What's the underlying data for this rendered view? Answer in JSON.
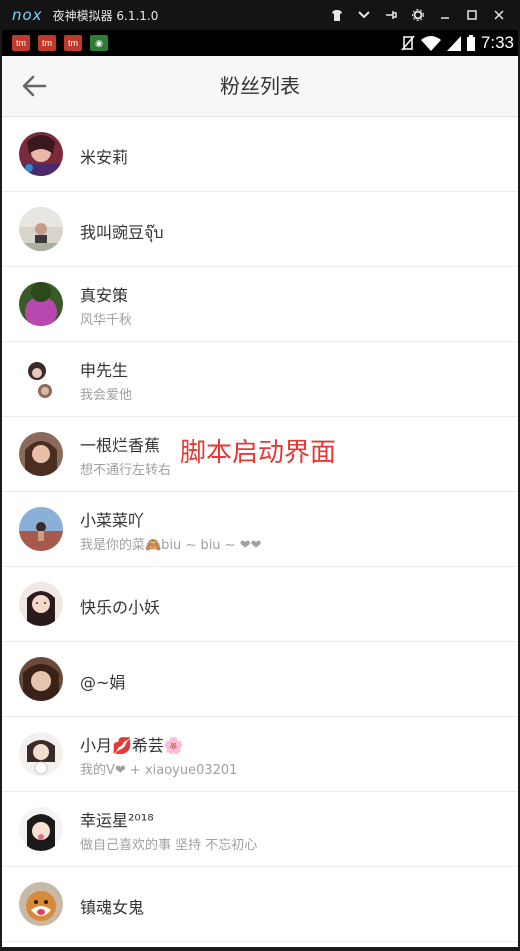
{
  "emulator": {
    "logo": "nox",
    "title": "夜神模拟器 6.1.1.0",
    "controls": [
      "shirt-icon",
      "chevron-down-icon",
      "pin-icon",
      "gear-icon",
      "minimize-icon",
      "maximize-icon",
      "close-icon"
    ]
  },
  "status_bar": {
    "time": "7:33",
    "notifications": [
      {
        "label": "tm",
        "color": "#c0392b"
      },
      {
        "label": "tm",
        "color": "#c0392b"
      },
      {
        "label": "tm",
        "color": "#c0392b"
      },
      {
        "label": "◉",
        "color": "#2e7d32"
      }
    ]
  },
  "header": {
    "title": "粉丝列表",
    "back_icon": "arrow-left-icon"
  },
  "fans": [
    {
      "name": "米安莉",
      "sub": ""
    },
    {
      "name": "我叫豌豆จุ๊บ",
      "sub": ""
    },
    {
      "name": "真安策",
      "sub": "风华千秋"
    },
    {
      "name": "申先生",
      "sub": "我会爱他"
    },
    {
      "name": "一根烂香蕉",
      "sub": "想不通行左转右"
    },
    {
      "name": "小菜菜吖",
      "sub": "我是你的菜🙈biu ~ biu ~ ❤❤"
    },
    {
      "name": "快乐の小妖",
      "sub": ""
    },
    {
      "name": "@~娟",
      "sub": ""
    },
    {
      "name": "小月💋希芸🌸",
      "sub": "我的V❤ + xiaoyue03201"
    },
    {
      "name": "幸运星²⁰¹⁸",
      "sub": "做自己喜欢的事 坚持   不忘初心"
    },
    {
      "name": "镇魂女鬼",
      "sub": ""
    }
  ],
  "overlay_text": "脚本启动界面",
  "colors": {
    "overlay": "#e53935",
    "title_bar": "#141414",
    "header_bg": "#f7f7f7"
  }
}
